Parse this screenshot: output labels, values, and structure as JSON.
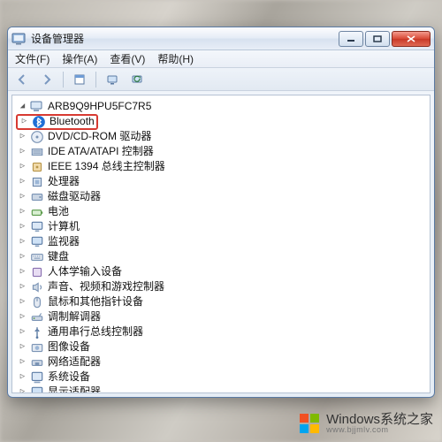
{
  "window": {
    "title": "设备管理器",
    "buttons": {
      "min": "min",
      "max": "max",
      "close": "close"
    }
  },
  "menubar": {
    "file": "文件(F)",
    "action": "操作(A)",
    "view": "查看(V)",
    "help": "帮助(H)"
  },
  "toolbar": {
    "back": "back",
    "forward": "forward",
    "props": "props",
    "scan": "scan",
    "refresh": "refresh"
  },
  "tree": {
    "root": "ARB9Q9HPU5FC7R5",
    "items": [
      {
        "label": "Bluetooth",
        "icon": "bluetooth",
        "highlight": true
      },
      {
        "label": "DVD/CD-ROM 驱动器",
        "icon": "disc"
      },
      {
        "label": "IDE ATA/ATAPI 控制器",
        "icon": "ide"
      },
      {
        "label": "IEEE 1394 总线主控制器",
        "icon": "firewire"
      },
      {
        "label": "处理器",
        "icon": "cpu"
      },
      {
        "label": "磁盘驱动器",
        "icon": "disk"
      },
      {
        "label": "电池",
        "icon": "battery"
      },
      {
        "label": "计算机",
        "icon": "computer"
      },
      {
        "label": "监视器",
        "icon": "monitor"
      },
      {
        "label": "键盘",
        "icon": "keyboard"
      },
      {
        "label": "人体学输入设备",
        "icon": "hid"
      },
      {
        "label": "声音、视频和游戏控制器",
        "icon": "sound"
      },
      {
        "label": "鼠标和其他指针设备",
        "icon": "mouse"
      },
      {
        "label": "调制解调器",
        "icon": "modem"
      },
      {
        "label": "通用串行总线控制器",
        "icon": "usb"
      },
      {
        "label": "图像设备",
        "icon": "imaging"
      },
      {
        "label": "网络适配器",
        "icon": "network"
      },
      {
        "label": "系统设备",
        "icon": "system"
      },
      {
        "label": "显示适配器",
        "icon": "display"
      }
    ]
  },
  "watermark": {
    "brand": "Windows",
    "suffix": "系统之家",
    "url": "www.bjjmlv.com"
  }
}
